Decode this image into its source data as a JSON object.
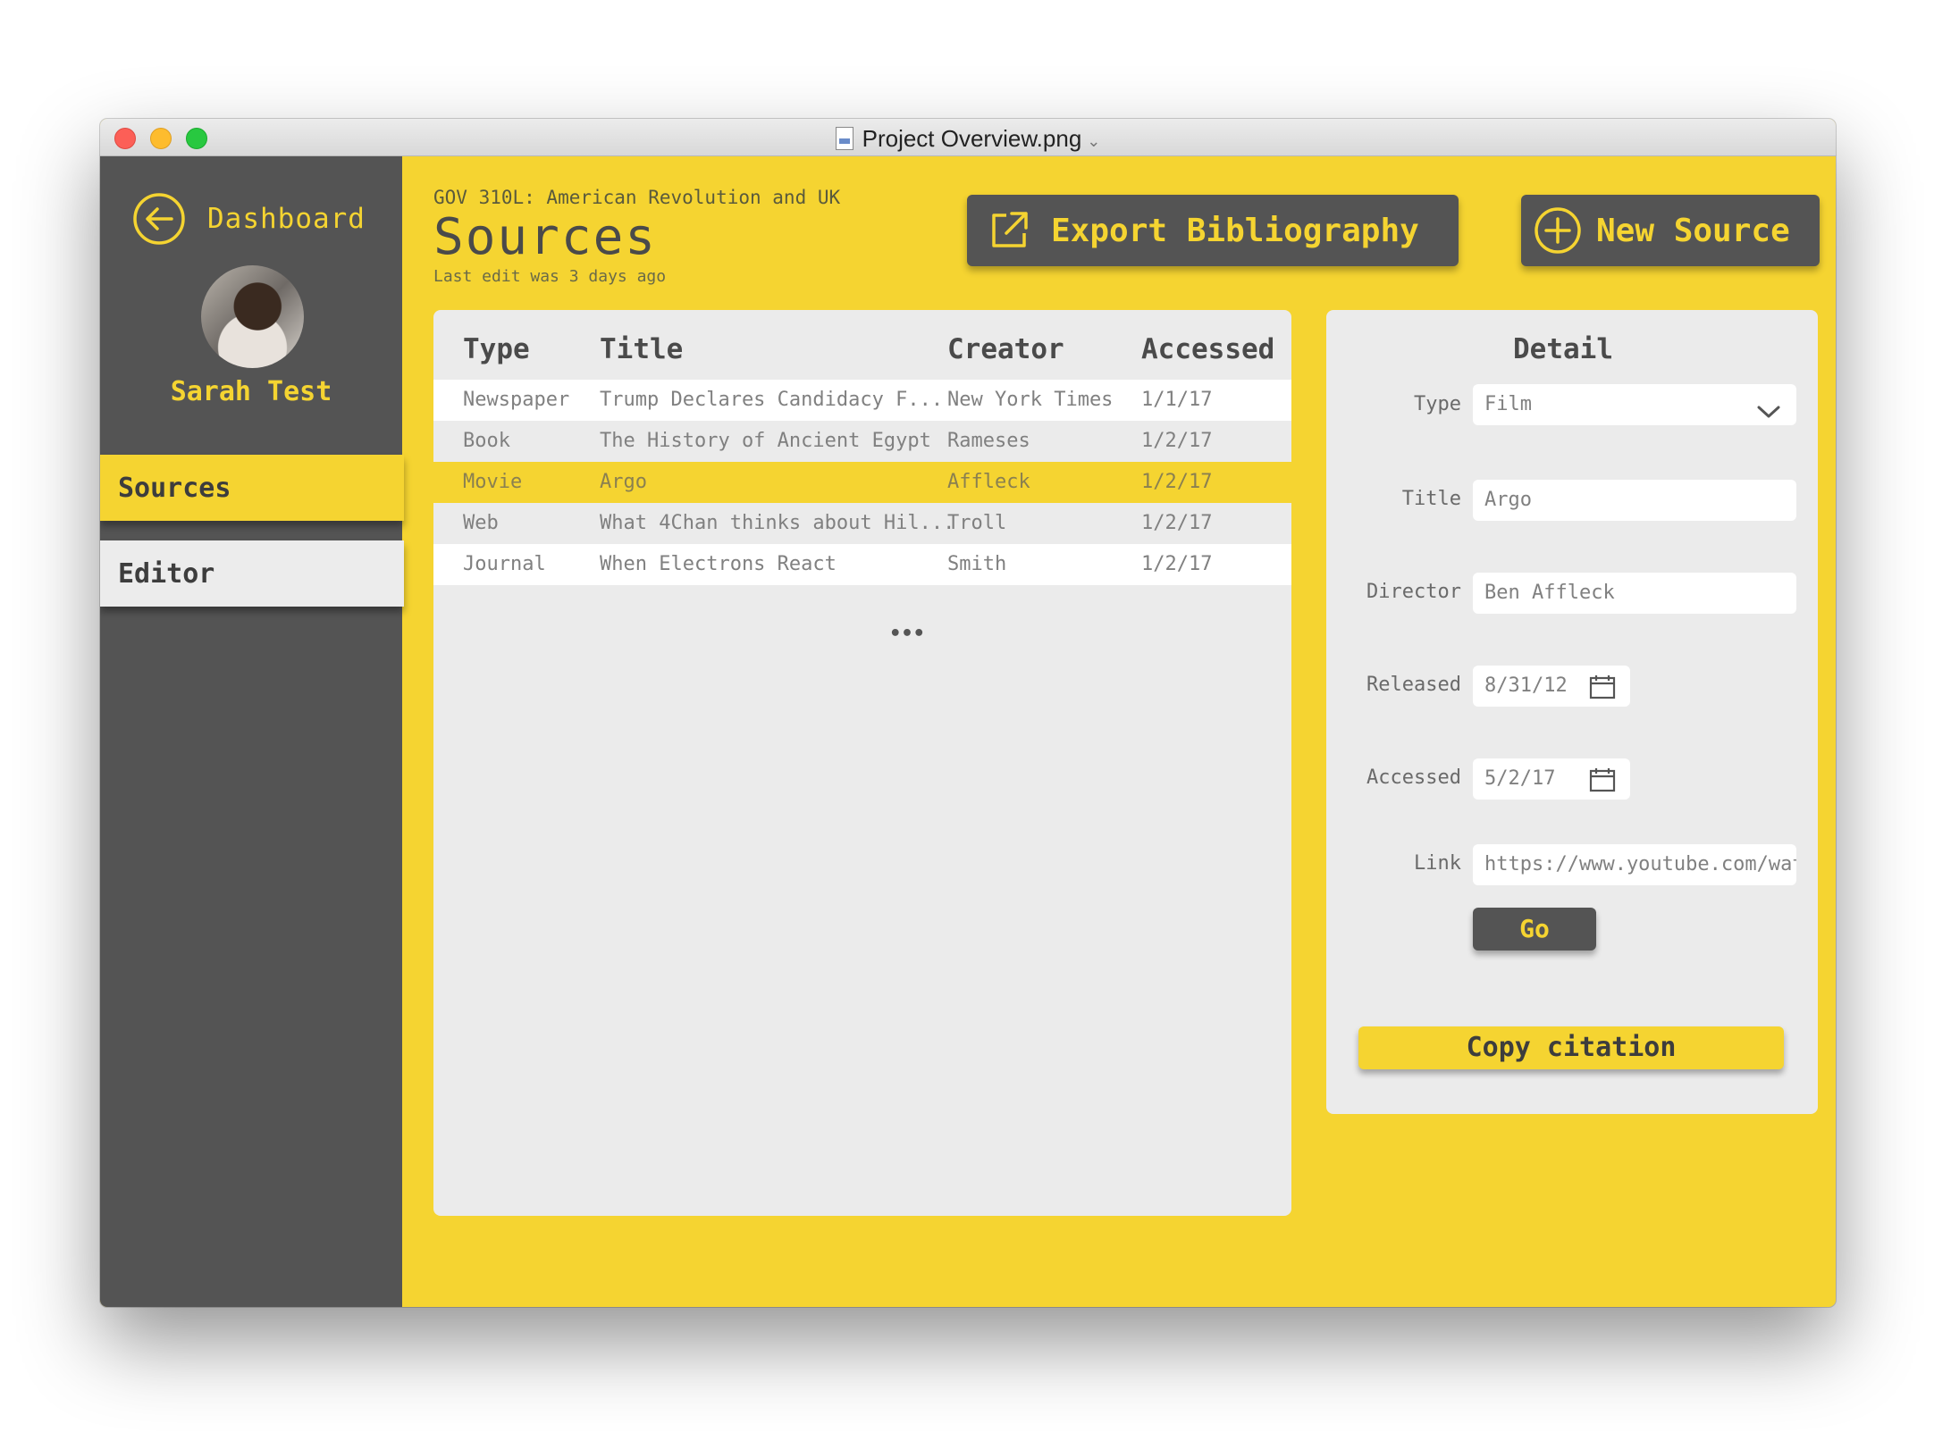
{
  "window": {
    "title": "Project Overview.png"
  },
  "sidebar": {
    "back_label": "Dashboard",
    "user_name": "Sarah Test",
    "nav": [
      {
        "label": "Sources"
      },
      {
        "label": "Editor"
      }
    ]
  },
  "header": {
    "course": "GOV 310L: American Revolution and UK",
    "title": "Sources",
    "subtitle": "Last edit was 3 days ago"
  },
  "toolbar": {
    "export_label": "Export Bibliography",
    "new_label": "New Source"
  },
  "table": {
    "columns": [
      "Type",
      "Title",
      "Creator",
      "Accessed"
    ],
    "rows": [
      {
        "type": "Newspaper",
        "title": "Trump Declares Candidacy F...",
        "creator": "New York Times",
        "accessed": "1/1/17"
      },
      {
        "type": "Book",
        "title": "The History of Ancient Egypt",
        "creator": "Rameses",
        "accessed": "1/2/17"
      },
      {
        "type": "Movie",
        "title": "Argo",
        "creator": "Affleck",
        "accessed": "1/2/17"
      },
      {
        "type": "Web",
        "title": "What 4Chan thinks about Hil...",
        "creator": "Troll",
        "accessed": "1/2/17"
      },
      {
        "type": "Journal",
        "title": "When Electrons React",
        "creator": "Smith",
        "accessed": "1/2/17"
      }
    ],
    "more": "•••"
  },
  "detail": {
    "heading": "Detail",
    "type_label": "Type",
    "type_value": "Film",
    "title_label": "Title",
    "title_value": "Argo",
    "director_label": "Director",
    "director_value": "Ben Affleck",
    "released_label": "Released",
    "released_value": "8/31/12",
    "accessed_label": "Accessed",
    "accessed_value": "5/2/17",
    "link_label": "Link",
    "link_value": "https://www.youtube.com/wat",
    "go_label": "Go",
    "copy_label": "Copy citation"
  },
  "colors": {
    "accent": "#f5d431",
    "sidebar": "#545454",
    "panel": "#ebebeb"
  }
}
